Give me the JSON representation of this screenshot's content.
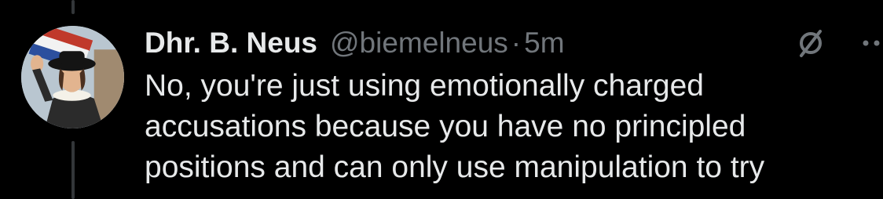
{
  "tweet": {
    "display_name": "Dhr. B. Neus",
    "handle": "@biemelneus",
    "separator": "·",
    "timestamp": "5m",
    "text": "No, you're just using emotionally charged\naccusations because you have no principled\npositions and can only use manipulation to try"
  },
  "icons": {
    "grok": "grok-slash-icon",
    "more": "more-horizontal-icon"
  },
  "colors": {
    "background": "#000000",
    "primary_text": "#e7e9ea",
    "secondary_text": "#71767b",
    "thread_line": "#333639"
  }
}
